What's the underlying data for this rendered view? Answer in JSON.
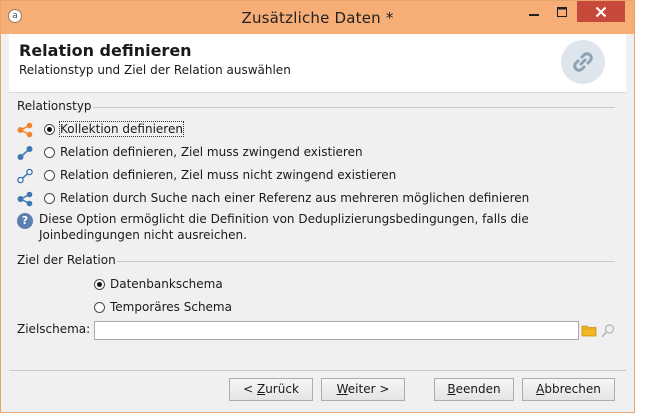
{
  "window": {
    "title": "Zusätzliche Daten *"
  },
  "header": {
    "title": "Relation definieren",
    "subtitle": "Relationstyp und Ziel der Relation auswählen"
  },
  "relationstyp": {
    "label": "Relationstyp",
    "options": [
      {
        "label": "Kollektion definieren",
        "checked": true,
        "icon": "collection-icon"
      },
      {
        "label": "Relation definieren, Ziel muss zwingend existieren",
        "checked": false,
        "icon": "link-required-icon"
      },
      {
        "label": "Relation definieren, Ziel muss nicht zwingend existieren",
        "checked": false,
        "icon": "link-optional-icon"
      },
      {
        "label": "Relation durch Suche nach einer Referenz aus mehreren möglichen definieren",
        "checked": false,
        "icon": "multi-reference-icon"
      }
    ],
    "info": "Diese Option ermöglicht die Definition von Deduplizierungsbedingungen, falls die Joinbedingungen nicht ausreichen."
  },
  "ziel": {
    "label": "Ziel der Relation",
    "options": [
      {
        "label": "Datenbankschema",
        "checked": true
      },
      {
        "label": "Temporäres Schema",
        "checked": false
      }
    ],
    "schema_label": "Zielschema:",
    "schema_value": ""
  },
  "footer": {
    "back_prefix": "< ",
    "back_key": "Z",
    "back_rest": "urück",
    "next_key": "W",
    "next_rest": "eiter >",
    "finish_key": "B",
    "finish_rest": "eenden",
    "cancel_key": "A",
    "cancel_rest": "bbrechen"
  },
  "colors": {
    "accent_orange": "#f0842c",
    "accent_blue": "#3f78b4",
    "titlebar": "#f7ad76",
    "close": "#c7493b"
  }
}
